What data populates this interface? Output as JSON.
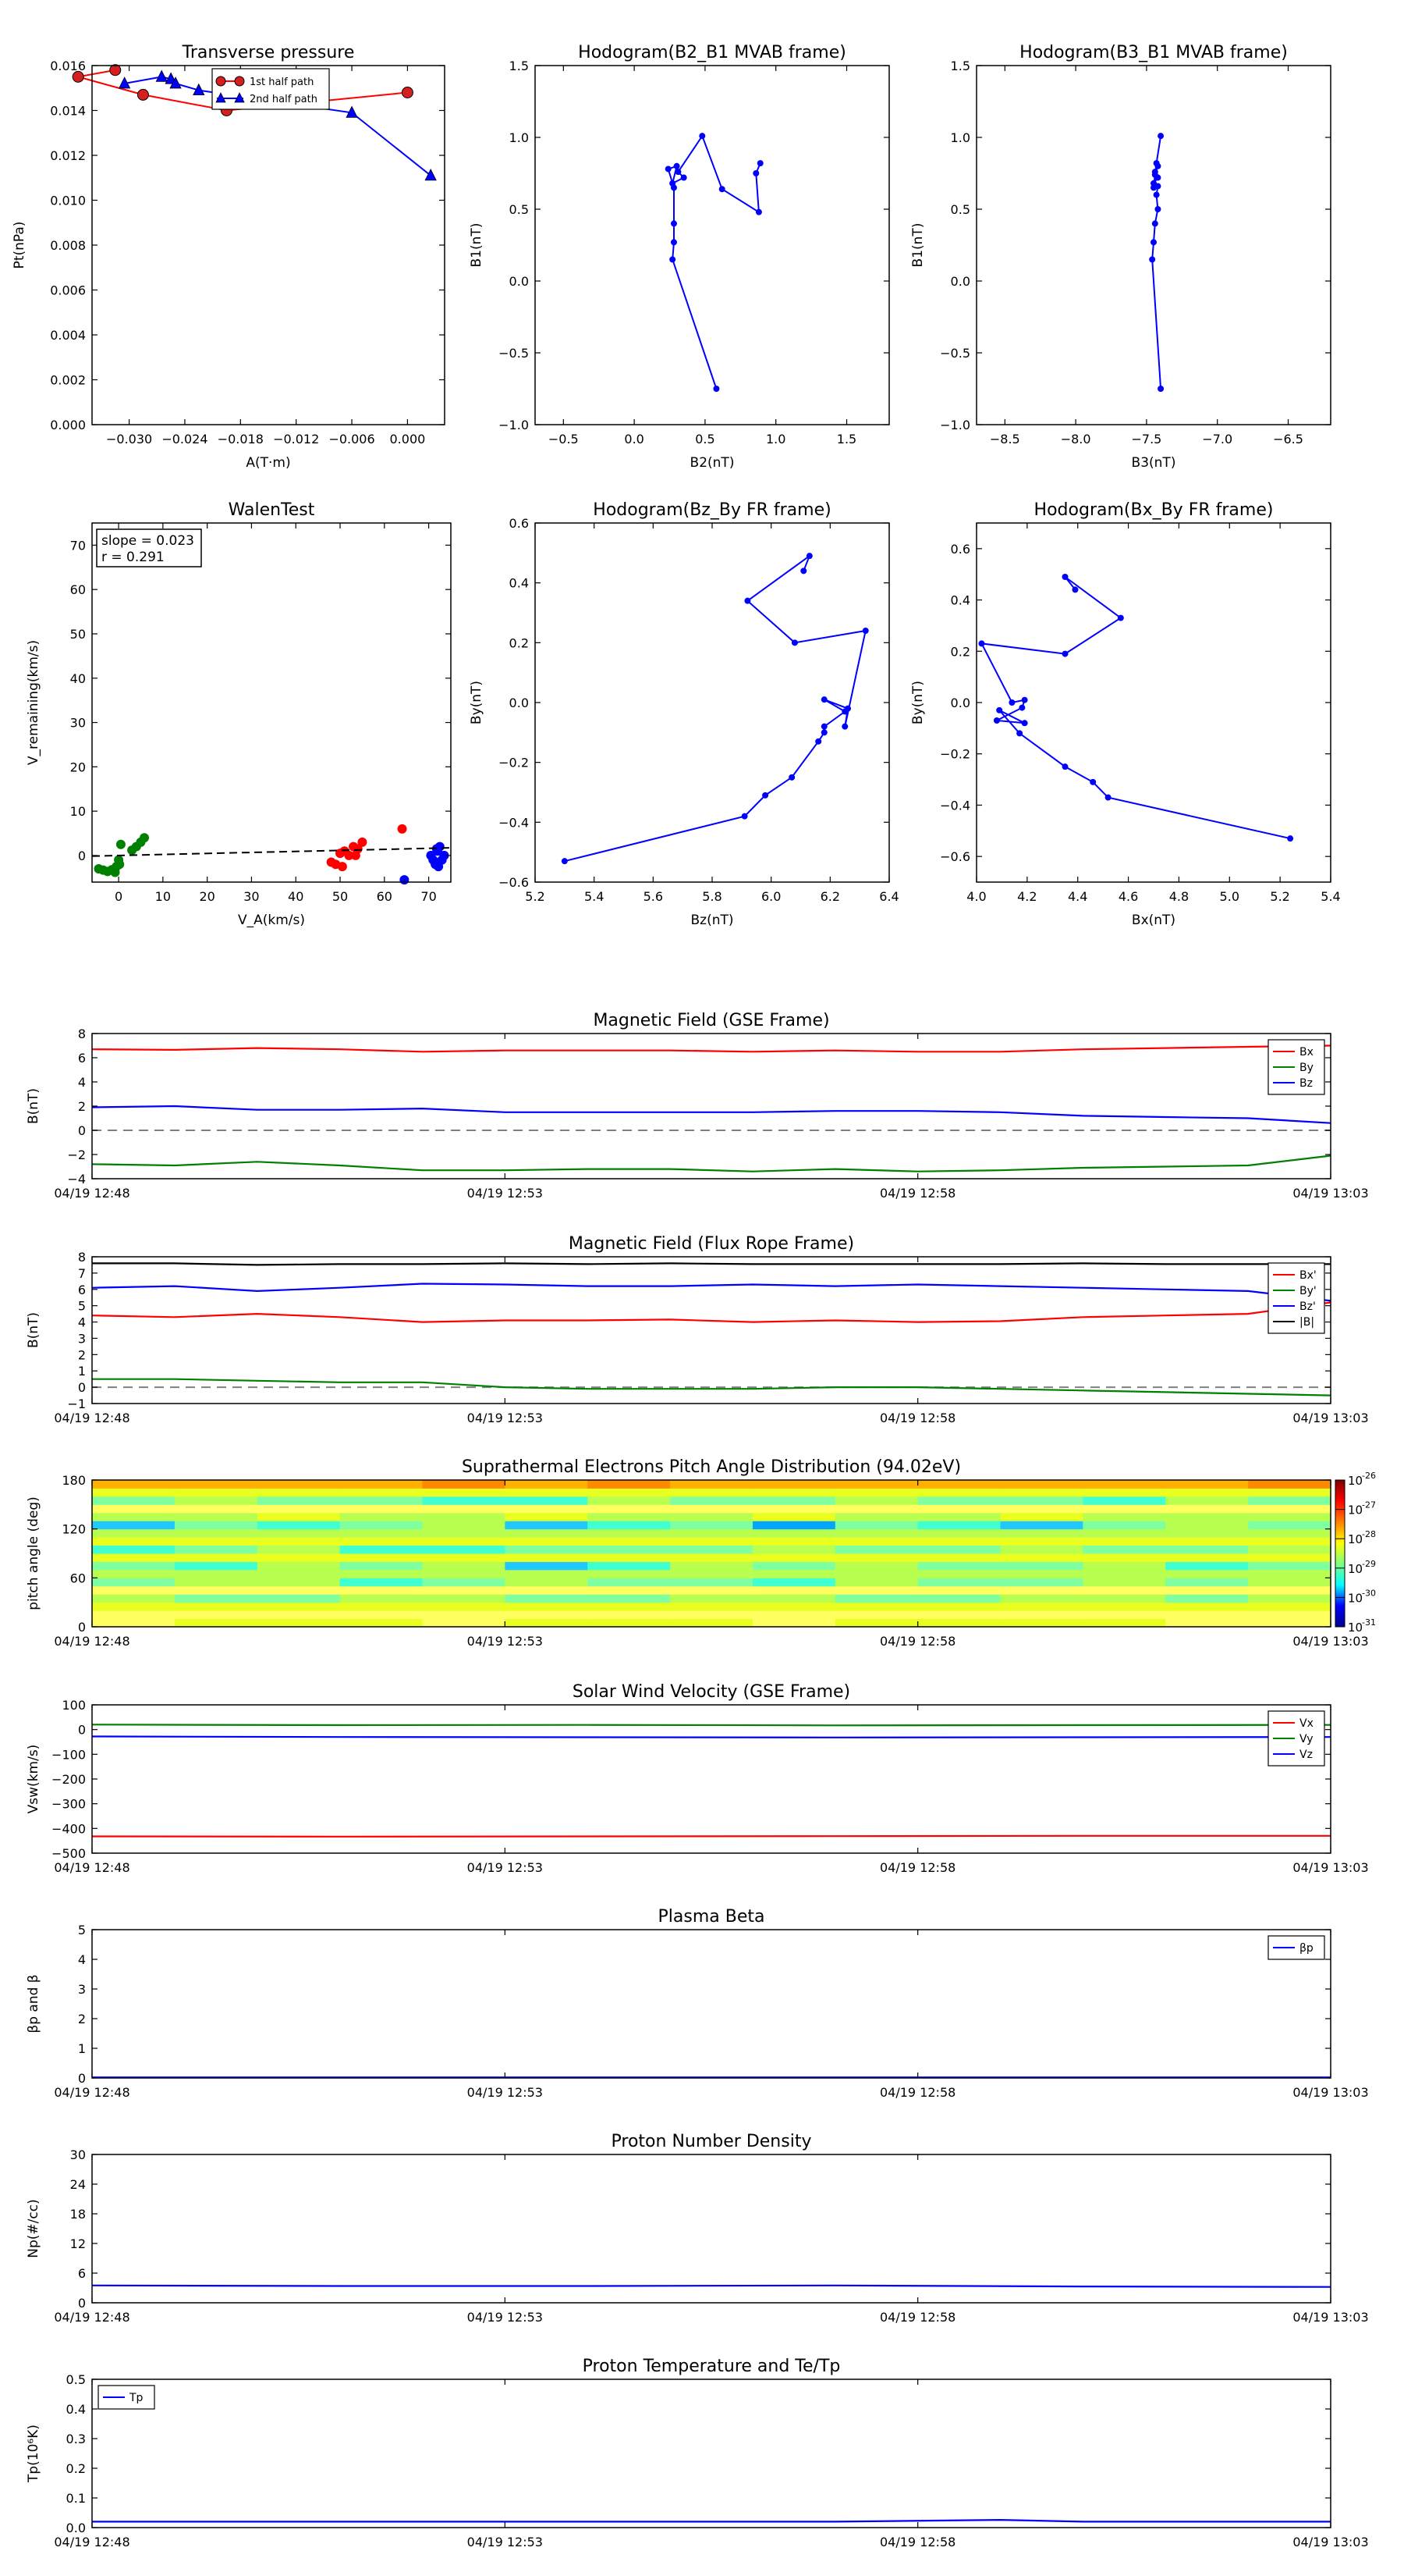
{
  "colors": {
    "red": "#ff0000",
    "blue": "#0000ff",
    "green": "#008000",
    "black": "#000000",
    "gray": "#808080",
    "marker_red": "#d62020"
  },
  "time_axis": {
    "range": [
      "04/19 12:48",
      "04/19 13:03"
    ],
    "ticks": [
      "04/19 12:48",
      "04/19 12:53",
      "04/19 12:58",
      "04/19 13:03"
    ]
  },
  "chart_data": [
    {
      "id": "transverse-pressure",
      "type": "line",
      "title": "Transverse pressure",
      "xlabel": "A(T·m)",
      "ylabel": "Pt(nPa)",
      "xlim": [
        -0.034,
        0.004
      ],
      "ylim": [
        0,
        0.016
      ],
      "grid": false,
      "legend": "top-right",
      "xticks": [
        -0.03,
        -0.024,
        -0.018,
        -0.012,
        -0.006,
        0.0
      ],
      "xtick_labels": [
        "−0.030",
        "−0.024",
        "−0.018",
        "−0.012",
        "−0.006",
        "0.000"
      ],
      "yticks": [
        0,
        0.002,
        0.004,
        0.006,
        0.008,
        0.01,
        0.012,
        0.014,
        0.016
      ],
      "ytick_labels": [
        "0.000",
        "0.002",
        "0.004",
        "0.006",
        "0.008",
        "0.010",
        "0.012",
        "0.014",
        "0.016"
      ],
      "series": [
        {
          "name": "1st half path",
          "color": "#ff0000",
          "marker": "circle",
          "x": [
            0.0,
            -0.0195,
            -0.0285,
            -0.0355,
            -0.0315
          ],
          "y": [
            0.0148,
            0.014,
            0.0147,
            0.0155,
            0.0158
          ]
        },
        {
          "name": "2nd half path",
          "color": "#0000ff",
          "marker": "triangle",
          "x": [
            -0.0305,
            -0.0265,
            -0.0255,
            -0.025,
            -0.0225,
            -0.006,
            0.0025
          ],
          "y": [
            0.0152,
            0.0155,
            0.0154,
            0.0152,
            0.0149,
            0.0139,
            0.0111
          ]
        }
      ]
    },
    {
      "id": "hodogram-b2-b1",
      "type": "line",
      "title": "Hodogram(B2_B1 MVAB frame)",
      "xlabel": "B2(nT)",
      "ylabel": "B1(nT)",
      "xlim": [
        -0.7,
        1.8
      ],
      "ylim": [
        -1.0,
        1.5
      ],
      "grid": false,
      "xticks": [
        -0.5,
        0.0,
        0.5,
        1.0,
        1.5
      ],
      "xtick_labels": [
        "−0.5",
        "0.0",
        "0.5",
        "1.0",
        "1.5"
      ],
      "yticks": [
        -1.0,
        -0.5,
        0.0,
        0.5,
        1.0,
        1.5
      ],
      "ytick_labels": [
        "−1.0",
        "−0.5",
        "0.0",
        "0.5",
        "1.0",
        "1.5"
      ],
      "series": [
        {
          "color": "#0000ff",
          "x": [
            0.58,
            0.27,
            0.28,
            0.28,
            0.28,
            0.24,
            0.3,
            0.27,
            0.35,
            0.31,
            0.48,
            0.62,
            0.88,
            0.86,
            0.89
          ],
          "y": [
            -0.75,
            0.15,
            0.27,
            0.4,
            0.65,
            0.78,
            0.8,
            0.68,
            0.72,
            0.76,
            1.01,
            0.64,
            0.48,
            0.75,
            0.82
          ]
        }
      ]
    },
    {
      "id": "hodogram-b3-b1",
      "type": "line",
      "title": "Hodogram(B3_B1 MVAB frame)",
      "xlabel": "B3(nT)",
      "ylabel": "B1(nT)",
      "xlim": [
        -8.7,
        -6.2
      ],
      "ylim": [
        -1.0,
        1.5
      ],
      "grid": false,
      "xticks": [
        -8.5,
        -8.0,
        -7.5,
        -7.0,
        -6.5
      ],
      "xtick_labels": [
        "−8.5",
        "−8.0",
        "−7.5",
        "−7.0",
        "−6.5"
      ],
      "yticks": [
        -1.0,
        -0.5,
        0.0,
        0.5,
        1.0,
        1.5
      ],
      "ytick_labels": [
        "−1.0",
        "−0.5",
        "0.0",
        "0.5",
        "1.0",
        "1.5"
      ],
      "series": [
        {
          "color": "#0000ff",
          "x": [
            -7.4,
            -7.46,
            -7.45,
            -7.44,
            -7.42,
            -7.43,
            -7.42,
            -7.45,
            -7.42,
            -7.44,
            -7.42,
            -7.44,
            -7.45,
            -7.43,
            -7.4
          ],
          "y": [
            -0.75,
            0.15,
            0.27,
            0.4,
            0.5,
            0.6,
            0.66,
            0.68,
            0.72,
            0.76,
            0.8,
            0.74,
            0.65,
            0.82,
            1.01
          ]
        }
      ]
    },
    {
      "id": "walen-test",
      "type": "scatter",
      "title": "WalenTest",
      "xlabel": "V_A(km/s)",
      "ylabel": "V_remaining(km/s)",
      "xlim": [
        -6,
        75
      ],
      "ylim": [
        -6,
        75
      ],
      "grid": false,
      "xticks": [
        0,
        10,
        20,
        30,
        40,
        50,
        60,
        70
      ],
      "xtick_labels": [
        "0",
        "10",
        "20",
        "30",
        "40",
        "50",
        "60",
        "70"
      ],
      "yticks": [
        0,
        10,
        20,
        30,
        40,
        50,
        60,
        70
      ],
      "ytick_labels": [
        "0",
        "10",
        "20",
        "30",
        "40",
        "50",
        "60",
        "70"
      ],
      "annotation": {
        "slope": "slope = 0.023",
        "r": "r = 0.291"
      },
      "fit": {
        "slope": 0.023,
        "x": [
          -6,
          75
        ]
      },
      "series": [
        {
          "color": "#008000",
          "x": [
            -4.5,
            -3.5,
            -2.5,
            -1.5,
            -0.5,
            0.2,
            -0.8,
            0.5,
            3.0,
            4.0,
            5.0,
            5.8,
            0.0
          ],
          "y": [
            -3.0,
            -3.3,
            -3.6,
            -3.2,
            -2.5,
            -2.0,
            -3.8,
            2.5,
            1.2,
            2.0,
            3.0,
            4.0,
            -1.0
          ]
        },
        {
          "color": "#ff0000",
          "x": [
            48.0,
            49.0,
            50.0,
            51.0,
            52.0,
            53.0,
            54.0,
            55.0,
            53.5,
            64.0,
            50.5
          ],
          "y": [
            -1.5,
            -2.0,
            0.5,
            1.0,
            0.0,
            2.0,
            1.5,
            3.0,
            0.0,
            6.0,
            -2.5
          ]
        },
        {
          "color": "#0000ff",
          "x": [
            70.5,
            71.0,
            71.5,
            72.0,
            72.5,
            73.0,
            73.5,
            72.2,
            71.8,
            64.5
          ],
          "y": [
            0.0,
            -1.0,
            -2.0,
            1.0,
            2.0,
            -1.0,
            0.0,
            -2.5,
            1.5,
            -5.5
          ]
        }
      ]
    },
    {
      "id": "hodogram-bz-by",
      "type": "line",
      "title": "Hodogram(Bz_By FR frame)",
      "xlabel": "Bz(nT)",
      "ylabel": "By(nT)",
      "xlim": [
        5.2,
        6.4
      ],
      "ylim": [
        -0.6,
        0.6
      ],
      "grid": false,
      "xticks": [
        5.2,
        5.4,
        5.6,
        5.8,
        6.0,
        6.2,
        6.4
      ],
      "xtick_labels": [
        "5.2",
        "5.4",
        "5.6",
        "5.8",
        "6.0",
        "6.2",
        "6.4"
      ],
      "yticks": [
        -0.6,
        -0.4,
        -0.2,
        0.0,
        0.2,
        0.4,
        0.6
      ],
      "ytick_labels": [
        "−0.6",
        "−0.4",
        "−0.2",
        "0.0",
        "0.2",
        "0.4",
        "0.6"
      ],
      "series": [
        {
          "color": "#0000ff",
          "x": [
            5.3,
            5.91,
            5.98,
            6.07,
            6.16,
            6.18,
            6.18,
            6.25,
            6.18,
            6.26,
            6.25,
            6.32,
            6.08,
            5.92,
            6.13,
            6.11
          ],
          "y": [
            -0.53,
            -0.38,
            -0.31,
            -0.25,
            -0.13,
            -0.1,
            -0.08,
            -0.03,
            0.01,
            -0.02,
            -0.08,
            0.24,
            0.2,
            0.34,
            0.49,
            0.44
          ]
        }
      ]
    },
    {
      "id": "hodogram-bx-by",
      "type": "line",
      "title": "Hodogram(Bx_By FR frame)",
      "xlabel": "Bx(nT)",
      "ylabel": "By(nT)",
      "xlim": [
        4.0,
        5.4
      ],
      "ylim": [
        -0.7,
        0.7
      ],
      "grid": false,
      "xticks": [
        4.0,
        4.2,
        4.4,
        4.6,
        4.8,
        5.0,
        5.2,
        5.4
      ],
      "xtick_labels": [
        "4.0",
        "4.2",
        "4.4",
        "4.6",
        "4.8",
        "5.0",
        "5.2",
        "5.4"
      ],
      "yticks": [
        -0.6,
        -0.4,
        -0.2,
        0.0,
        0.2,
        0.4,
        0.6
      ],
      "ytick_labels": [
        "−0.6",
        "−0.4",
        "−0.2",
        "0.0",
        "0.2",
        "0.4",
        "0.6"
      ],
      "series": [
        {
          "color": "#0000ff",
          "x": [
            5.24,
            4.52,
            4.46,
            4.35,
            4.17,
            4.09,
            4.19,
            4.08,
            4.18,
            4.19,
            4.14,
            4.02,
            4.35,
            4.57,
            4.35,
            4.39
          ],
          "y": [
            -0.53,
            -0.37,
            -0.31,
            -0.25,
            -0.12,
            -0.03,
            -0.08,
            -0.07,
            -0.02,
            0.01,
            0.0,
            0.23,
            0.19,
            0.33,
            0.49,
            0.44
          ]
        }
      ]
    },
    {
      "id": "mag-gse",
      "type": "line",
      "title": "Magnetic Field (GSE Frame)",
      "ylabel": "B(nT)",
      "ylim": [
        -4,
        8
      ],
      "grid": false,
      "legend": "top-right",
      "zero_line": true,
      "yticks": [
        -4,
        -2,
        0,
        2,
        4,
        6,
        8
      ],
      "ytick_labels": [
        "−4",
        "−2",
        "0",
        "2",
        "4",
        "6",
        "8"
      ],
      "t": [
        0,
        1,
        2,
        3,
        4,
        5,
        6,
        7,
        8,
        9,
        10,
        11,
        12,
        13,
        14,
        15
      ],
      "series": [
        {
          "name": "Bx",
          "color": "#ff0000",
          "values": [
            6.7,
            6.65,
            6.8,
            6.7,
            6.5,
            6.6,
            6.6,
            6.6,
            6.5,
            6.6,
            6.5,
            6.5,
            6.7,
            6.8,
            6.9,
            7.0
          ]
        },
        {
          "name": "By",
          "color": "#008000",
          "values": [
            -2.8,
            -2.9,
            -2.6,
            -2.9,
            -3.3,
            -3.3,
            -3.2,
            -3.2,
            -3.4,
            -3.2,
            -3.4,
            -3.3,
            -3.1,
            -3.0,
            -2.9,
            -2.1
          ]
        },
        {
          "name": "Bz",
          "color": "#0000ff",
          "values": [
            1.9,
            2.0,
            1.7,
            1.7,
            1.8,
            1.5,
            1.5,
            1.5,
            1.5,
            1.6,
            1.6,
            1.5,
            1.2,
            1.1,
            1.0,
            0.6
          ]
        }
      ]
    },
    {
      "id": "mag-fr",
      "type": "line",
      "title": "Magnetic Field (Flux Rope Frame)",
      "ylabel": "B(nT)",
      "ylim": [
        -1,
        8
      ],
      "grid": false,
      "legend": "top-right",
      "zero_line": true,
      "yticks": [
        -1,
        0,
        1,
        2,
        3,
        4,
        5,
        6,
        7,
        8
      ],
      "ytick_labels": [
        "−1",
        "0",
        "1",
        "2",
        "3",
        "4",
        "5",
        "6",
        "7",
        "8"
      ],
      "t": [
        0,
        1,
        2,
        3,
        4,
        5,
        6,
        7,
        8,
        9,
        10,
        11,
        12,
        13,
        14,
        15
      ],
      "series": [
        {
          "name": "Bx'",
          "color": "#ff0000",
          "values": [
            4.4,
            4.3,
            4.5,
            4.3,
            4.0,
            4.1,
            4.1,
            4.15,
            4.0,
            4.1,
            4.0,
            4.05,
            4.3,
            4.4,
            4.5,
            5.2
          ]
        },
        {
          "name": "By'",
          "color": "#008000",
          "values": [
            0.5,
            0.5,
            0.4,
            0.3,
            0.3,
            0.0,
            -0.1,
            -0.1,
            -0.1,
            0.0,
            0.0,
            -0.1,
            -0.2,
            -0.3,
            -0.4,
            -0.5
          ]
        },
        {
          "name": "Bz'",
          "color": "#0000ff",
          "values": [
            6.1,
            6.2,
            5.9,
            6.1,
            6.35,
            6.3,
            6.2,
            6.2,
            6.3,
            6.2,
            6.3,
            6.2,
            6.1,
            6.0,
            5.9,
            5.3
          ]
        },
        {
          "name": "|B|",
          "color": "#000000",
          "values": [
            7.6,
            7.6,
            7.5,
            7.55,
            7.55,
            7.6,
            7.55,
            7.6,
            7.55,
            7.55,
            7.55,
            7.55,
            7.6,
            7.55,
            7.55,
            7.55
          ]
        }
      ]
    },
    {
      "id": "pad",
      "type": "heatmap",
      "title": "Suprathermal Electrons Pitch Angle Distribution (94.02eV)",
      "ylabel": "pitch angle (deg)",
      "ylim": [
        0,
        180
      ],
      "yticks": [
        0,
        60,
        120,
        180
      ],
      "ytick_labels": [
        "0",
        "60",
        "120",
        "180"
      ],
      "colorbar": {
        "scale": "log",
        "range": [
          1e-31,
          1e-26
        ],
        "tick_exponents": [
          "-26",
          "-27",
          "-28",
          "-29",
          "-30",
          "-31"
        ]
      },
      "columns": 15,
      "rows": 18,
      "cells": [
        "IHHHIHHHIHHHHIII",
        "IIIIIIIIIIIIIIII",
        "HHHHHHHHHHHHHHHH",
        "GFFGGFFGGFFGGFGG",
        "IIIIIIIIIIIIIIII",
        "FGGEFGFFEGFFGFGG",
        "GGGGGGGGGGGGGGGG",
        "FEGFGDEGFGFFGEFG",
        "HHHHHHHHHHHHHHHH",
        "EFGEEFFFGFFGFFGF",
        "HHHHHHHHHHHHHHHH",
        "GGGGGGGGGGGGGGGG",
        "DFEFGDEFCFEDFGFF",
        "GGHGGHGGHGGHGGGG",
        "IIIIIIIIIIIIIIII",
        "FGFFEEGFFGFFEGFF",
        "HHHHHHHHHHHHHHHH",
        "KKKKLKLKKKKKKKLK"
      ]
    },
    {
      "id": "sw-velocity",
      "type": "line",
      "title": "Solar Wind Velocity (GSE Frame)",
      "ylabel": "Vsw(km/s)",
      "ylim": [
        -500,
        100
      ],
      "grid": false,
      "legend": "top-right",
      "yticks": [
        -500,
        -400,
        -300,
        -200,
        -100,
        0,
        100
      ],
      "ytick_labels": [
        "−500",
        "−400",
        "−300",
        "−200",
        "−100",
        "0",
        "100"
      ],
      "t": [
        0,
        3,
        6,
        9,
        12,
        15
      ],
      "series": [
        {
          "name": "Vx",
          "color": "#ff0000",
          "values": [
            -432,
            -433,
            -432,
            -431,
            -430,
            -430
          ]
        },
        {
          "name": "Vy",
          "color": "#008000",
          "values": [
            20,
            18,
            19,
            17,
            18,
            19
          ]
        },
        {
          "name": "Vz",
          "color": "#0000ff",
          "values": [
            -28,
            -30,
            -31,
            -32,
            -31,
            -30
          ]
        }
      ]
    },
    {
      "id": "plasma-beta",
      "type": "line",
      "title": "Plasma Beta",
      "ylabel": "βp and β",
      "ylim": [
        0,
        5
      ],
      "grid": false,
      "legend": "top-right",
      "yticks": [
        0,
        1,
        2,
        3,
        4,
        5
      ],
      "ytick_labels": [
        "0",
        "1",
        "2",
        "3",
        "4",
        "5"
      ],
      "t": [
        0,
        3,
        6,
        9,
        12,
        15
      ],
      "series": [
        {
          "name": "βp",
          "color": "#0000ff",
          "values": [
            0.02,
            0.02,
            0.02,
            0.02,
            0.02,
            0.02
          ]
        }
      ]
    },
    {
      "id": "proton-density",
      "type": "line",
      "title": "Proton Number Density",
      "ylabel": "Np(#/cc)",
      "ylim": [
        0,
        30
      ],
      "grid": false,
      "yticks": [
        0,
        6,
        12,
        18,
        24,
        30
      ],
      "ytick_labels": [
        "0",
        "6",
        "12",
        "18",
        "24",
        "30"
      ],
      "t": [
        0,
        3,
        6,
        9,
        12,
        15
      ],
      "series": [
        {
          "color": "#0000ff",
          "values": [
            3.5,
            3.4,
            3.4,
            3.5,
            3.3,
            3.2
          ]
        }
      ]
    },
    {
      "id": "proton-temp",
      "type": "line",
      "title": "Proton Temperature and Te/Tp",
      "ylabel": "Tp(10⁶K)",
      "ylim": [
        0,
        0.5
      ],
      "grid": false,
      "legend": "top-left",
      "yticks": [
        0,
        0.1,
        0.2,
        0.3,
        0.4,
        0.5
      ],
      "ytick_labels": [
        "0.0",
        "0.1",
        "0.2",
        "0.3",
        "0.4",
        "0.5"
      ],
      "t": [
        0,
        3,
        6,
        9,
        11,
        12,
        15
      ],
      "series": [
        {
          "name": "Tp",
          "color": "#0000ff",
          "values": [
            0.02,
            0.02,
            0.02,
            0.02,
            0.026,
            0.02,
            0.02
          ]
        }
      ]
    }
  ]
}
